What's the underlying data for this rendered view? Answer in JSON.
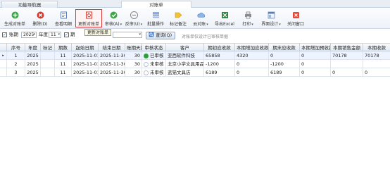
{
  "tabs": [
    {
      "label": "功能导航器"
    },
    {
      "label": "对账单"
    }
  ],
  "toolbar": {
    "items": [
      {
        "label": "生成对账单",
        "icon": "add-icon"
      },
      {
        "label": "删除(D)",
        "icon": "delete-icon"
      },
      {
        "label": "查看明细",
        "icon": "view-detail-icon"
      },
      {
        "label": "更新对账单",
        "icon": "refresh-statement-icon"
      },
      {
        "label": "审核(A)",
        "icon": "approve-icon"
      },
      {
        "label": "反审(U)",
        "icon": "unapprove-icon"
      },
      {
        "label": "批量操作",
        "icon": "batch-icon"
      },
      {
        "label": "标记备注",
        "icon": "tag-icon"
      },
      {
        "label": "云对账",
        "icon": "cloud-icon"
      },
      {
        "label": "导出Excel",
        "icon": "excel-icon"
      },
      {
        "label": "打印",
        "icon": "print-icon"
      },
      {
        "label": "界面设计",
        "icon": "design-icon"
      },
      {
        "label": "关闭窗口",
        "icon": "close-icon"
      }
    ],
    "tooltip": "更新对账单"
  },
  "filter": {
    "period_checkbox_label": "账期",
    "year_value": "2025",
    "year_unit": "年度",
    "month_value": "11",
    "period_label": "期",
    "query_button": "查询(Q)",
    "hint": "对账单仅设计已审核单据"
  },
  "grid": {
    "columns": [
      "序号",
      "年度",
      "标记",
      "期数",
      "起始日期",
      "结束日期",
      "账期天数",
      "审核状态",
      "客户",
      "期初应收款",
      "本期增加应收款",
      "期末应收款",
      "本期增加预收款",
      "本期销售金额",
      "本期收款"
    ],
    "rows": [
      {
        "no": "1",
        "year": "2025",
        "mark": "",
        "period": "11",
        "start": "2025-11-01",
        "end": "2025-11-30",
        "days": "30",
        "status": "已审核",
        "status_color": "#2e9d3a",
        "customer": "亚西软件科技",
        "open_ar": "65858",
        "add_ar": "4320",
        "a": "0",
        "end_ar": "0",
        "b": "",
        "sales": "70178",
        "receipt": "70178"
      },
      {
        "no": "2",
        "year": "2025",
        "mark": "",
        "period": "11",
        "start": "2025-11-01",
        "end": "2025-11-30",
        "days": "30",
        "status": "未审核",
        "status_color": "#d9dde3",
        "customer": "北京小学文具用品店",
        "open_ar": "-1200",
        "add_ar": "0",
        "a": "",
        "end_ar": "-1200",
        "b": "0",
        "sales": "0",
        "receipt": "0"
      },
      {
        "no": "3",
        "year": "2025",
        "mark": "",
        "period": "11",
        "start": "2025-11-01",
        "end": "2025-11-30",
        "days": "30",
        "status": "未审核",
        "status_color": "#d9dde3",
        "customer": "蓝猫文具店",
        "open_ar": "6189",
        "add_ar": "0",
        "a": "",
        "end_ar": "6189",
        "b": "0",
        "sales": "0",
        "receipt": "0"
      }
    ]
  }
}
